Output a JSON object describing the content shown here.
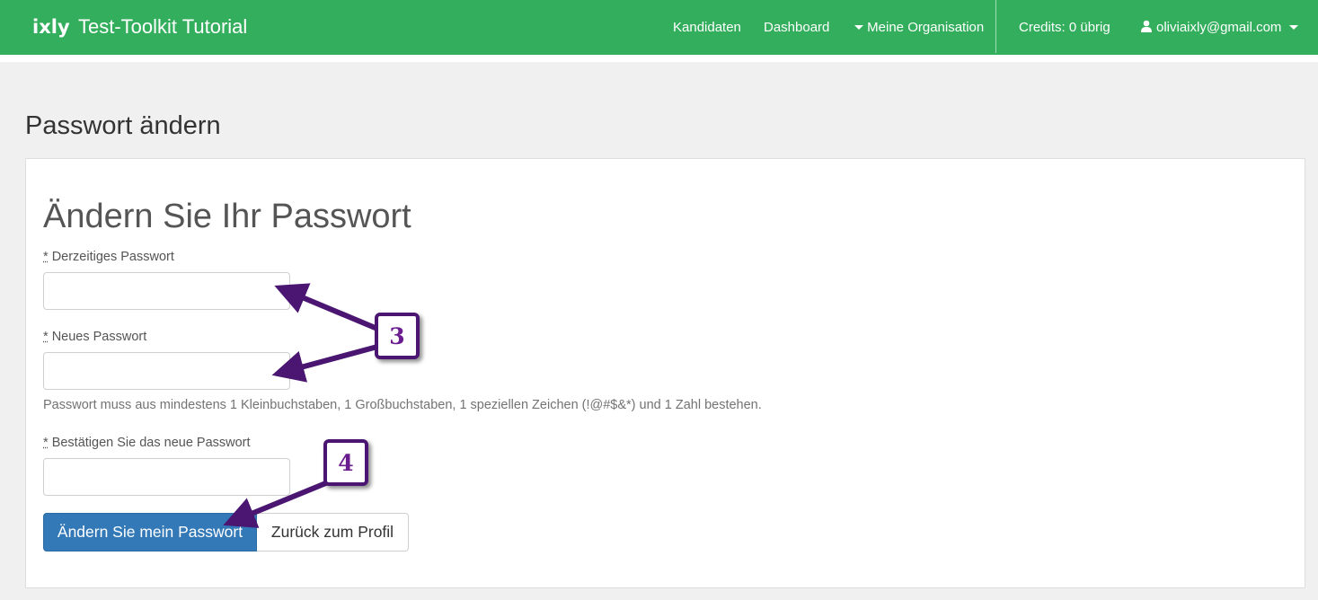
{
  "navbar": {
    "logo": "ixly",
    "title": "Test-Toolkit Tutorial",
    "links": {
      "kandidaten": "Kandidaten",
      "dashboard": "Dashboard",
      "organisation": "Meine Organisation"
    },
    "credits": "Credits: 0 übrig",
    "user_email": "oliviaixly@gmail.com",
    "bg_color": "#33ae5d"
  },
  "page": {
    "title": "Passwort ändern"
  },
  "form": {
    "heading": "Ändern Sie Ihr Passwort",
    "required_marker": "*",
    "current_password": {
      "label": "Derzeitiges Passwort",
      "value": ""
    },
    "new_password": {
      "label": "Neues Passwort",
      "value": ""
    },
    "password_help": "Passwort muss aus mindestens 1 Kleinbuchstaben, 1 Großbuchstaben, 1 speziellen Zeichen (!@#$&*) und 1 Zahl bestehen.",
    "confirm_password": {
      "label": "Bestätigen Sie das neue Passwort",
      "value": ""
    },
    "submit_label": "Ändern Sie mein Passwort",
    "back_label": "Zurück zum Profil",
    "primary_color": "#3379b8"
  },
  "annotations": {
    "step3": "3",
    "step4": "4",
    "color": "#4a1672"
  }
}
